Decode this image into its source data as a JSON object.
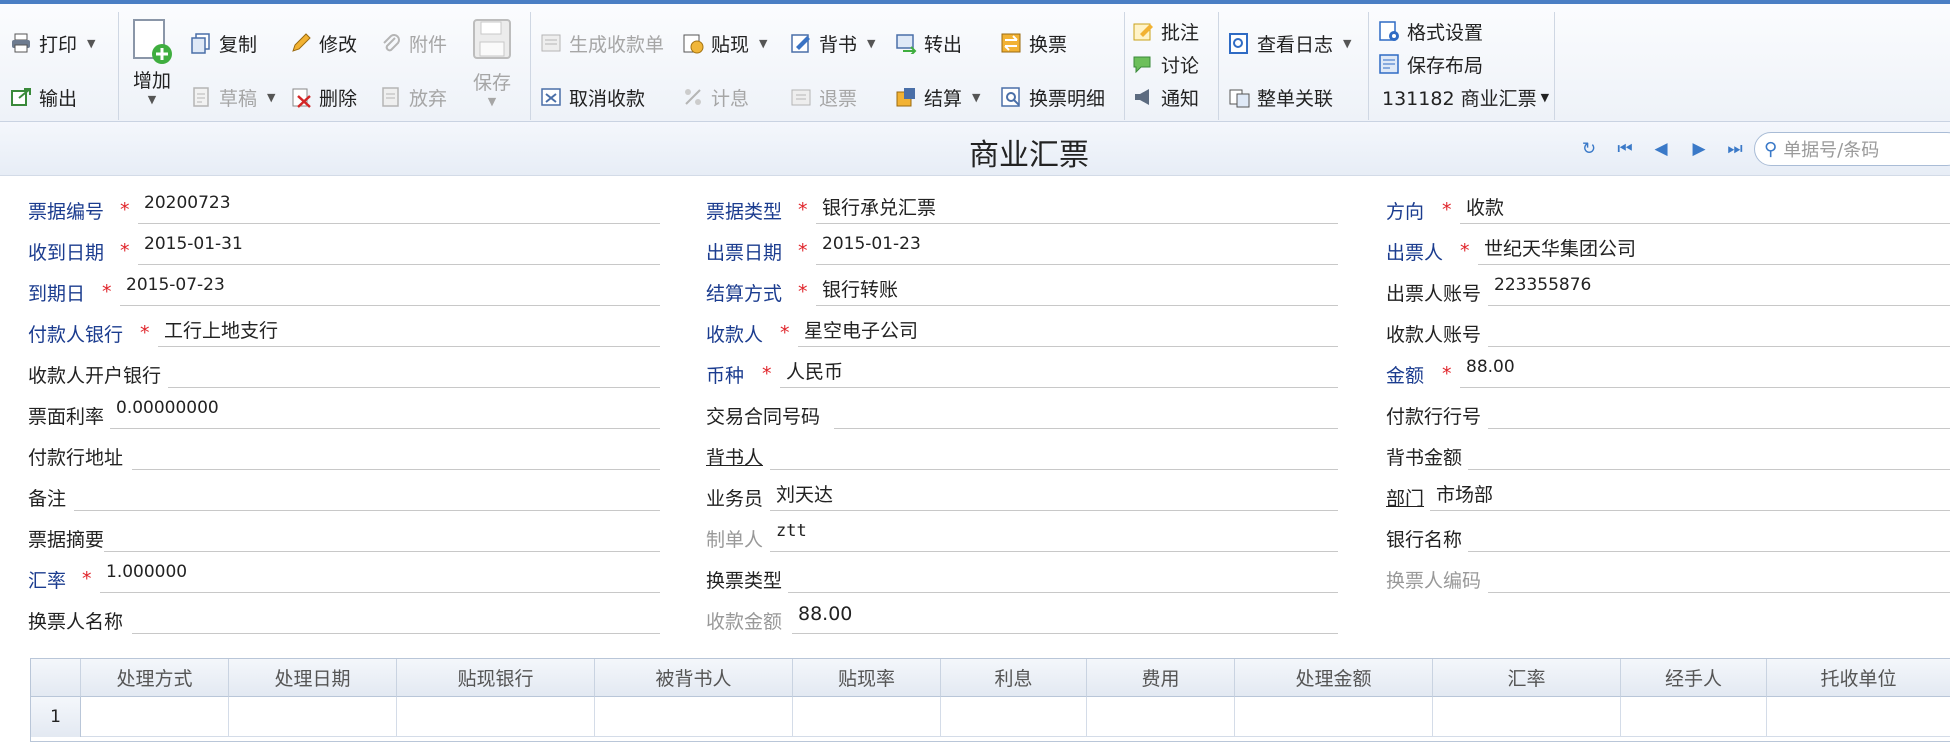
{
  "toolbar": {
    "print": "打印",
    "export": "输出",
    "add": "增加",
    "copy": "复制",
    "draft": "草稿",
    "edit": "修改",
    "delete": "删除",
    "attachment": "附件",
    "discard": "放弃",
    "save": "保存",
    "generate_receipt": "生成收款单",
    "cancel_receipt": "取消收款",
    "discount": "贴现",
    "accrue": "计息",
    "endorse": "背书",
    "return_ticket": "退票",
    "transfer_out": "转出",
    "settle": "结算",
    "exchange": "换票",
    "exchange_detail": "换票明细",
    "annotate": "批注",
    "discuss": "讨论",
    "notify": "通知",
    "view_log": "查看日志",
    "doc_link": "整单关联",
    "format_settings": "格式设置",
    "save_layout": "保存布局",
    "template": "131182 商业汇票"
  },
  "title": "商业汇票",
  "search": {
    "placeholder": "单据号/条码"
  },
  "form": {
    "bill_no": {
      "label": "票据编号",
      "value": "20200723"
    },
    "received_date": {
      "label": "收到日期",
      "value": "2015-01-31"
    },
    "due_date": {
      "label": "到期日",
      "value": "2015-07-23"
    },
    "payer_bank": {
      "label": "付款人银行",
      "value": "工行上地支行"
    },
    "payee_bank": {
      "label": "收款人开户银行",
      "value": ""
    },
    "face_rate": {
      "label": "票面利率",
      "value": "0.00000000"
    },
    "payer_bank_address": {
      "label": "付款行地址",
      "value": ""
    },
    "remark": {
      "label": "备注",
      "value": ""
    },
    "summary": {
      "label": "票据摘要",
      "value": ""
    },
    "exchange_rate": {
      "label": "汇率",
      "value": "1.000000"
    },
    "exchanger_name": {
      "label": "换票人名称",
      "value": ""
    },
    "bill_type": {
      "label": "票据类型",
      "value": "银行承兑汇票"
    },
    "issue_date": {
      "label": "出票日期",
      "value": "2015-01-23"
    },
    "settlement": {
      "label": "结算方式",
      "value": "银行转账"
    },
    "payee": {
      "label": "收款人",
      "value": "星空电子公司"
    },
    "currency": {
      "label": "币种",
      "value": "人民币"
    },
    "contract_no": {
      "label": "交易合同号码",
      "value": ""
    },
    "endorser": {
      "label": "背书人",
      "value": ""
    },
    "salesman": {
      "label": "业务员",
      "value": "刘天达"
    },
    "maker": {
      "label": "制单人",
      "value": "ztt"
    },
    "exchange_type": {
      "label": "换票类型",
      "value": ""
    },
    "received_amount": {
      "label": "收款金额",
      "value": "88.00"
    },
    "direction": {
      "label": "方向",
      "value": "收款"
    },
    "drawer": {
      "label": "出票人",
      "value": "世纪天华集团公司"
    },
    "drawer_account": {
      "label": "出票人账号",
      "value": "223355876"
    },
    "payee_account": {
      "label": "收款人账号",
      "value": ""
    },
    "amount": {
      "label": "金额",
      "value": "88.00"
    },
    "payer_bank_no": {
      "label": "付款行行号",
      "value": ""
    },
    "endorse_amount": {
      "label": "背书金额",
      "value": ""
    },
    "department": {
      "label": "部门",
      "value": "市场部"
    },
    "bank_name": {
      "label": "银行名称",
      "value": ""
    },
    "exchanger_code": {
      "label": "换票人编码",
      "value": ""
    }
  },
  "grid": {
    "headers": [
      "处理方式",
      "处理日期",
      "贴现银行",
      "被背书人",
      "贴现率",
      "利息",
      "费用",
      "处理金额",
      "汇率",
      "经手人",
      "托收单位"
    ],
    "row_number": "1"
  },
  "colors": {
    "accent": "#4a7fc4",
    "label_blue": "#1b3c8f",
    "required": "#e0242a"
  }
}
